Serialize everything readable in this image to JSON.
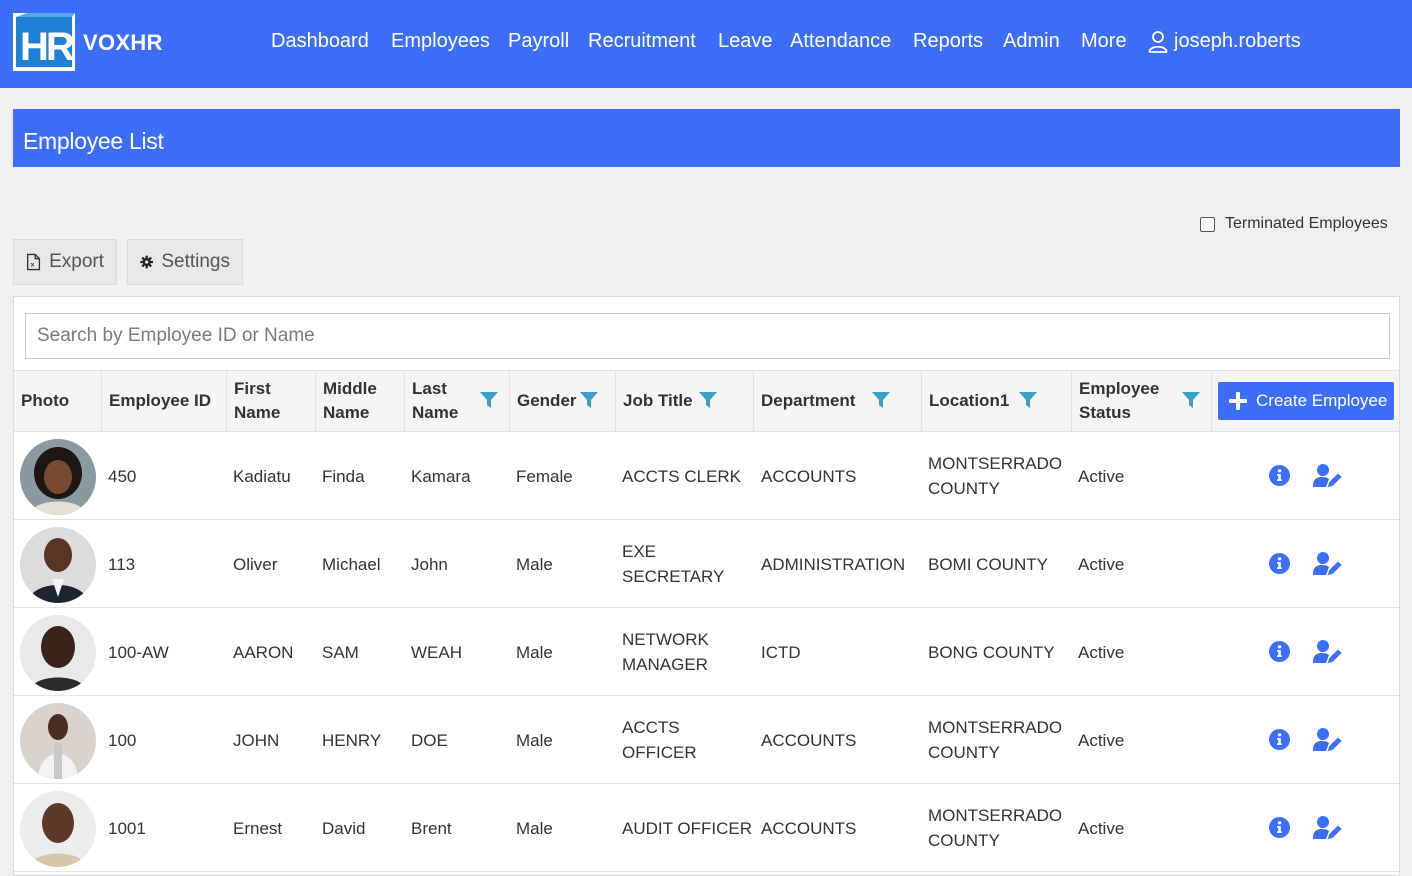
{
  "app": {
    "logo_alt": "HR",
    "name": "VOXHR"
  },
  "nav": [
    {
      "label": "Dashboard"
    },
    {
      "label": "Employees"
    },
    {
      "label": "Payroll"
    },
    {
      "label": "Recruitment"
    },
    {
      "label": "Leave"
    },
    {
      "label": "Attendance"
    },
    {
      "label": "Reports"
    },
    {
      "label": "Admin"
    },
    {
      "label": "More"
    }
  ],
  "user": {
    "name": "joseph.roberts",
    "icon": "user-icon"
  },
  "page": {
    "title": "Employee List"
  },
  "filters": {
    "terminated_label": "Terminated Employees",
    "terminated_checked": false
  },
  "toolbar": {
    "export_label": "Export",
    "export_icon": "excel-file-icon",
    "settings_label": "Settings",
    "settings_icon": "gear-icon"
  },
  "search": {
    "placeholder": "Search by Employee ID or Name",
    "value": ""
  },
  "table": {
    "columns": {
      "photo": "Photo",
      "employee_id": "Employee ID",
      "first_name": "First Name",
      "middle_name": "Middle Name",
      "last_name": "Last Name",
      "gender": "Gender",
      "job_title": "Job Title",
      "department": "Department",
      "location": "Location1",
      "status": "Employee Status"
    },
    "create_label": "Create Employee",
    "rows": [
      {
        "id": "450",
        "first": "Kadiatu",
        "middle": "Finda",
        "last": "Kamara",
        "gender": "Female",
        "job": "ACCTS CLERK",
        "dept": "ACCOUNTS",
        "location": "MONTSERRADO COUNTY",
        "status": "Active"
      },
      {
        "id": "113",
        "first": "Oliver",
        "middle": "Michael",
        "last": "John",
        "gender": "Male",
        "job": "EXE SECRETARY",
        "dept": "ADMINISTRATION",
        "location": "BOMI COUNTY",
        "status": "Active"
      },
      {
        "id": "100-AW",
        "first": "AARON",
        "middle": "SAM",
        "last": "WEAH",
        "gender": "Male",
        "job": "NETWORK MANAGER",
        "dept": "ICTD",
        "location": "BONG COUNTY",
        "status": "Active"
      },
      {
        "id": "100",
        "first": "JOHN",
        "middle": "HENRY",
        "last": "DOE",
        "gender": "Male",
        "job": "ACCTS OFFICER",
        "dept": "ACCOUNTS",
        "location": "MONTSERRADO COUNTY",
        "status": "Active"
      },
      {
        "id": "1001",
        "first": "Ernest",
        "middle": "David",
        "last": "Brent",
        "gender": "Male",
        "job": "AUDIT OFFICER",
        "dept": "ACCOUNTS",
        "location": "MONTSERRADO COUNTY",
        "status": "Active"
      }
    ]
  },
  "colors": {
    "primary": "#3d6ef9",
    "filter_icon": "#3aa0c9",
    "action_icon": "#3d6ef9"
  }
}
